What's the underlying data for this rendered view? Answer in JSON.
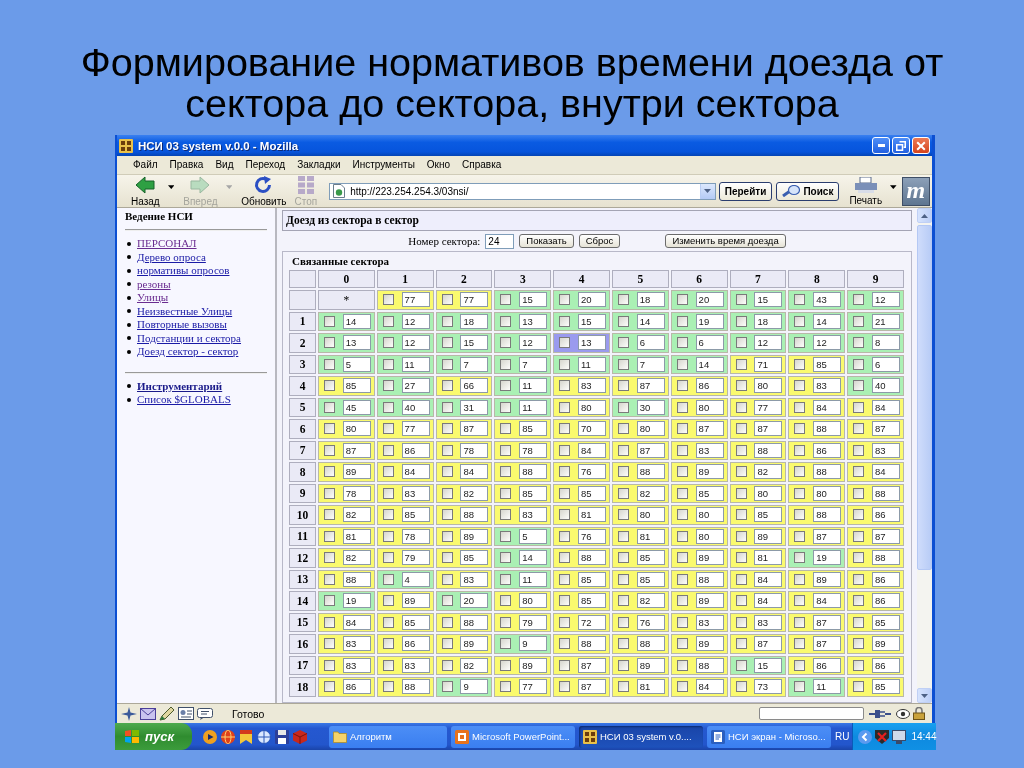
{
  "slide": {
    "title": "Формирование нормативов времени доезда от сектора до сектора, внутри сектора"
  },
  "window": {
    "title": "НСИ 03 system v.0.0 - Mozilla"
  },
  "menu": [
    "Файл",
    "Правка",
    "Вид",
    "Переход",
    "Закладки",
    "Инструменты",
    "Окно",
    "Справка"
  ],
  "toolbar": {
    "nav": [
      {
        "kind": "back",
        "label": "Назад",
        "disabled": false,
        "dropdown": true
      },
      {
        "kind": "forward",
        "label": "Вперед",
        "disabled": true,
        "dropdown": true
      },
      {
        "kind": "reload",
        "label": "Обновить",
        "disabled": false,
        "dropdown": false
      },
      {
        "kind": "stop",
        "label": "Стоп",
        "disabled": true,
        "dropdown": false
      }
    ],
    "address": "http://223.254.254.3/03nsi/",
    "go": "Перейти",
    "search": "Поиск",
    "print": "Печать",
    "logo": "m"
  },
  "sidebar": {
    "title": "Ведение НСИ",
    "groups": [
      {
        "items": [
          {
            "label": "ПЕРСОНАЛ",
            "visited": true,
            "emphasized": false
          },
          {
            "label": "Дерево опроса",
            "visited": false,
            "emphasized": false
          },
          {
            "label": "нормативы опросов",
            "visited": false,
            "emphasized": false
          },
          {
            "label": "резоны",
            "visited": true,
            "emphasized": false
          },
          {
            "label": "Улицы",
            "visited": true,
            "emphasized": false
          },
          {
            "label": "Неизвестные Улицы",
            "visited": false,
            "emphasized": false
          },
          {
            "label": "Повторные вызовы",
            "visited": false,
            "emphasized": false
          },
          {
            "label": "Подстанции и сектора",
            "visited": false,
            "emphasized": false
          },
          {
            "label": "Доезд сектор - сектор",
            "visited": false,
            "emphasized": false
          }
        ]
      },
      {
        "items": [
          {
            "label": "Инструментарий",
            "visited": false,
            "emphasized": true
          },
          {
            "label": "Список $GLOBALS",
            "visited": false,
            "emphasized": false
          }
        ]
      }
    ]
  },
  "panel": {
    "heading": "Доезд из сектора в сектор",
    "sector_label": "Номер сектора:",
    "sector_value": "24",
    "buttons": [
      "Показать",
      "Сброс"
    ],
    "change_button": "Изменить время доезда"
  },
  "table": {
    "legend": "Связанные сектора",
    "columns": [
      "0",
      "1",
      "2",
      "3",
      "4",
      "5",
      "6",
      "7",
      "8",
      "9"
    ],
    "rows": [
      {
        "cells": [
          {
            "kind": "label",
            "value": "*"
          },
          {
            "kind": "input",
            "value": "77",
            "color": "#fafa6e",
            "checked": false
          },
          {
            "kind": "input",
            "value": "77",
            "color": "#fafa6e",
            "checked": false
          },
          {
            "kind": "input",
            "value": "15",
            "color": "#aaf0b4",
            "checked": false
          },
          {
            "kind": "input",
            "value": "20",
            "color": "#aaf0b4",
            "checked": false
          },
          {
            "kind": "input",
            "value": "18",
            "color": "#aaf0b4",
            "checked": false
          },
          {
            "kind": "input",
            "value": "20",
            "color": "#aaf0b4",
            "checked": false
          },
          {
            "kind": "input",
            "value": "15",
            "color": "#aaf0b4",
            "checked": false
          },
          {
            "kind": "input",
            "value": "43",
            "color": "#aaf0b4",
            "checked": false
          },
          {
            "kind": "input",
            "value": "12",
            "color": "#aaf0b4",
            "checked": false
          }
        ]
      },
      {
        "label": "1",
        "cells": [
          {
            "value": "14",
            "color": "#aaf0b4",
            "checked": false
          },
          {
            "value": "12",
            "color": "#aaf0b4",
            "checked": false
          },
          {
            "value": "18",
            "color": "#aaf0b4",
            "checked": false
          },
          {
            "value": "13",
            "color": "#aaf0b4",
            "checked": false
          },
          {
            "value": "15",
            "color": "#aaf0b4",
            "checked": false
          },
          {
            "value": "14",
            "color": "#aaf0b4",
            "checked": false
          },
          {
            "value": "19",
            "color": "#aaf0b4",
            "checked": false
          },
          {
            "value": "18",
            "color": "#aaf0b4",
            "checked": false
          },
          {
            "value": "14",
            "color": "#aaf0b4",
            "checked": false
          },
          {
            "value": "21",
            "color": "#aaf0b4",
            "checked": false
          }
        ]
      },
      {
        "label": "2",
        "cells": [
          {
            "value": "13",
            "color": "#aaf0b4",
            "checked": false
          },
          {
            "value": "12",
            "color": "#aaf0b4",
            "checked": false
          },
          {
            "value": "15",
            "color": "#aaf0b4",
            "checked": false
          },
          {
            "value": "12",
            "color": "#aaf0b4",
            "checked": false
          },
          {
            "value": "13",
            "color": "#9a9aee",
            "checked": false
          },
          {
            "value": "6",
            "color": "#aaf0b4",
            "checked": false
          },
          {
            "value": "6",
            "color": "#aaf0b4",
            "checked": false
          },
          {
            "value": "12",
            "color": "#aaf0b4",
            "checked": false
          },
          {
            "value": "12",
            "color": "#aaf0b4",
            "checked": false
          },
          {
            "value": "8",
            "color": "#aaf0b4",
            "checked": false
          }
        ]
      },
      {
        "label": "3",
        "cells": [
          {
            "value": "5",
            "color": "#aaf0b4",
            "checked": false
          },
          {
            "value": "11",
            "color": "#aaf0b4",
            "checked": false
          },
          {
            "value": "7",
            "color": "#aaf0b4",
            "checked": false
          },
          {
            "value": "7",
            "color": "#aaf0b4",
            "checked": false
          },
          {
            "value": "11",
            "color": "#aaf0b4",
            "checked": false
          },
          {
            "value": "7",
            "color": "#aaf0b4",
            "checked": false
          },
          {
            "value": "14",
            "color": "#aaf0b4",
            "checked": false
          },
          {
            "value": "71",
            "color": "#fafa6e",
            "checked": false
          },
          {
            "value": "85",
            "color": "#fafa6e",
            "checked": false
          },
          {
            "value": "6",
            "color": "#aaf0b4",
            "checked": false
          }
        ]
      },
      {
        "label": "4",
        "cells": [
          {
            "value": "85",
            "color": "#fafa6e",
            "checked": false
          },
          {
            "value": "27",
            "color": "#aaf0b4",
            "checked": false
          },
          {
            "value": "66",
            "color": "#fafa6e",
            "checked": false
          },
          {
            "value": "11",
            "color": "#aaf0b4",
            "checked": false
          },
          {
            "value": "83",
            "color": "#fafa6e",
            "checked": false
          },
          {
            "value": "87",
            "color": "#fafa6e",
            "checked": false
          },
          {
            "value": "86",
            "color": "#fafa6e",
            "checked": false
          },
          {
            "value": "80",
            "color": "#fafa6e",
            "checked": false
          },
          {
            "value": "83",
            "color": "#fafa6e",
            "checked": false
          },
          {
            "value": "40",
            "color": "#aaf0b4",
            "checked": false
          }
        ]
      },
      {
        "label": "5",
        "cells": [
          {
            "value": "45",
            "color": "#aaf0b4",
            "checked": false
          },
          {
            "value": "40",
            "color": "#aaf0b4",
            "checked": false
          },
          {
            "value": "31",
            "color": "#aaf0b4",
            "checked": false
          },
          {
            "value": "11",
            "color": "#aaf0b4",
            "checked": false
          },
          {
            "value": "80",
            "color": "#fafa6e",
            "checked": false
          },
          {
            "value": "30",
            "color": "#aaf0b4",
            "checked": false
          },
          {
            "value": "80",
            "color": "#fafa6e",
            "checked": false
          },
          {
            "value": "77",
            "color": "#fafa6e",
            "checked": false
          },
          {
            "value": "84",
            "color": "#fafa6e",
            "checked": false
          },
          {
            "value": "84",
            "color": "#fafa6e",
            "checked": false
          }
        ]
      },
      {
        "label": "6",
        "cells": [
          {
            "value": "80",
            "color": "#fafa6e",
            "checked": false
          },
          {
            "value": "77",
            "color": "#fafa6e",
            "checked": false
          },
          {
            "value": "87",
            "color": "#fafa6e",
            "checked": false
          },
          {
            "value": "85",
            "color": "#fafa6e",
            "checked": false
          },
          {
            "value": "70",
            "color": "#fafa6e",
            "checked": false
          },
          {
            "value": "80",
            "color": "#fafa6e",
            "checked": false
          },
          {
            "value": "87",
            "color": "#fafa6e",
            "checked": false
          },
          {
            "value": "87",
            "color": "#fafa6e",
            "checked": false
          },
          {
            "value": "88",
            "color": "#fafa6e",
            "checked": false
          },
          {
            "value": "87",
            "color": "#fafa6e",
            "checked": false
          }
        ]
      },
      {
        "label": "7",
        "cells": [
          {
            "value": "87",
            "color": "#fafa6e",
            "checked": false
          },
          {
            "value": "86",
            "color": "#fafa6e",
            "checked": false
          },
          {
            "value": "78",
            "color": "#fafa6e",
            "checked": false
          },
          {
            "value": "78",
            "color": "#fafa6e",
            "checked": false
          },
          {
            "value": "84",
            "color": "#fafa6e",
            "checked": false
          },
          {
            "value": "87",
            "color": "#fafa6e",
            "checked": false
          },
          {
            "value": "83",
            "color": "#fafa6e",
            "checked": false
          },
          {
            "value": "88",
            "color": "#fafa6e",
            "checked": false
          },
          {
            "value": "86",
            "color": "#fafa6e",
            "checked": false
          },
          {
            "value": "83",
            "color": "#fafa6e",
            "checked": false
          }
        ]
      },
      {
        "label": "8",
        "cells": [
          {
            "value": "89",
            "color": "#fafa6e",
            "checked": false
          },
          {
            "value": "84",
            "color": "#fafa6e",
            "checked": false
          },
          {
            "value": "84",
            "color": "#fafa6e",
            "checked": false
          },
          {
            "value": "88",
            "color": "#fafa6e",
            "checked": false
          },
          {
            "value": "76",
            "color": "#fafa6e",
            "checked": false
          },
          {
            "value": "88",
            "color": "#fafa6e",
            "checked": false
          },
          {
            "value": "89",
            "color": "#fafa6e",
            "checked": false
          },
          {
            "value": "82",
            "color": "#fafa6e",
            "checked": false
          },
          {
            "value": "88",
            "color": "#fafa6e",
            "checked": false
          },
          {
            "value": "84",
            "color": "#fafa6e",
            "checked": false
          }
        ]
      },
      {
        "label": "9",
        "cells": [
          {
            "value": "78",
            "color": "#fafa6e",
            "checked": false
          },
          {
            "value": "83",
            "color": "#fafa6e",
            "checked": false
          },
          {
            "value": "82",
            "color": "#fafa6e",
            "checked": false
          },
          {
            "value": "85",
            "color": "#fafa6e",
            "checked": false
          },
          {
            "value": "85",
            "color": "#fafa6e",
            "checked": false
          },
          {
            "value": "82",
            "color": "#fafa6e",
            "checked": false
          },
          {
            "value": "85",
            "color": "#fafa6e",
            "checked": false
          },
          {
            "value": "80",
            "color": "#fafa6e",
            "checked": false
          },
          {
            "value": "80",
            "color": "#fafa6e",
            "checked": false
          },
          {
            "value": "88",
            "color": "#fafa6e",
            "checked": false
          }
        ]
      },
      {
        "label": "10",
        "cells": [
          {
            "value": "82",
            "color": "#fafa6e",
            "checked": false
          },
          {
            "value": "85",
            "color": "#fafa6e",
            "checked": false
          },
          {
            "value": "88",
            "color": "#fafa6e",
            "checked": false
          },
          {
            "value": "83",
            "color": "#fafa6e",
            "checked": false
          },
          {
            "value": "81",
            "color": "#fafa6e",
            "checked": false
          },
          {
            "value": "80",
            "color": "#fafa6e",
            "checked": false
          },
          {
            "value": "80",
            "color": "#fafa6e",
            "checked": false
          },
          {
            "value": "85",
            "color": "#fafa6e",
            "checked": false
          },
          {
            "value": "88",
            "color": "#fafa6e",
            "checked": false
          },
          {
            "value": "86",
            "color": "#fafa6e",
            "checked": false
          }
        ]
      },
      {
        "label": "11",
        "cells": [
          {
            "value": "81",
            "color": "#fafa6e",
            "checked": false
          },
          {
            "value": "78",
            "color": "#fafa6e",
            "checked": false
          },
          {
            "value": "89",
            "color": "#fafa6e",
            "checked": false
          },
          {
            "value": "5",
            "color": "#aaf0b4",
            "checked": false
          },
          {
            "value": "76",
            "color": "#fafa6e",
            "checked": false
          },
          {
            "value": "81",
            "color": "#fafa6e",
            "checked": false
          },
          {
            "value": "80",
            "color": "#fafa6e",
            "checked": false
          },
          {
            "value": "89",
            "color": "#fafa6e",
            "checked": false
          },
          {
            "value": "87",
            "color": "#fafa6e",
            "checked": false
          },
          {
            "value": "87",
            "color": "#fafa6e",
            "checked": false
          }
        ]
      },
      {
        "label": "12",
        "cells": [
          {
            "value": "82",
            "color": "#fafa6e",
            "checked": false
          },
          {
            "value": "79",
            "color": "#fafa6e",
            "checked": false
          },
          {
            "value": "85",
            "color": "#fafa6e",
            "checked": false
          },
          {
            "value": "14",
            "color": "#aaf0b4",
            "checked": false
          },
          {
            "value": "88",
            "color": "#fafa6e",
            "checked": false
          },
          {
            "value": "85",
            "color": "#fafa6e",
            "checked": false
          },
          {
            "value": "89",
            "color": "#fafa6e",
            "checked": false
          },
          {
            "value": "81",
            "color": "#fafa6e",
            "checked": false
          },
          {
            "value": "19",
            "color": "#aaf0b4",
            "checked": false
          },
          {
            "value": "88",
            "color": "#fafa6e",
            "checked": false
          }
        ]
      },
      {
        "label": "13",
        "cells": [
          {
            "value": "88",
            "color": "#fafa6e",
            "checked": false
          },
          {
            "value": "4",
            "color": "#aaf0b4",
            "checked": false
          },
          {
            "value": "83",
            "color": "#fafa6e",
            "checked": false
          },
          {
            "value": "11",
            "color": "#aaf0b4",
            "checked": false
          },
          {
            "value": "85",
            "color": "#fafa6e",
            "checked": false
          },
          {
            "value": "85",
            "color": "#fafa6e",
            "checked": false
          },
          {
            "value": "88",
            "color": "#fafa6e",
            "checked": false
          },
          {
            "value": "84",
            "color": "#fafa6e",
            "checked": false
          },
          {
            "value": "89",
            "color": "#fafa6e",
            "checked": false
          },
          {
            "value": "86",
            "color": "#fafa6e",
            "checked": false
          }
        ]
      },
      {
        "label": "14",
        "cells": [
          {
            "value": "19",
            "color": "#aaf0b4",
            "checked": false
          },
          {
            "value": "89",
            "color": "#fafa6e",
            "checked": false
          },
          {
            "value": "20",
            "color": "#aaf0b4",
            "checked": false
          },
          {
            "value": "80",
            "color": "#fafa6e",
            "checked": false
          },
          {
            "value": "85",
            "color": "#fafa6e",
            "checked": false
          },
          {
            "value": "82",
            "color": "#fafa6e",
            "checked": false
          },
          {
            "value": "89",
            "color": "#fafa6e",
            "checked": false
          },
          {
            "value": "84",
            "color": "#fafa6e",
            "checked": false
          },
          {
            "value": "84",
            "color": "#fafa6e",
            "checked": false
          },
          {
            "value": "86",
            "color": "#fafa6e",
            "checked": false
          }
        ]
      },
      {
        "label": "15",
        "cells": [
          {
            "value": "84",
            "color": "#fafa6e",
            "checked": false
          },
          {
            "value": "85",
            "color": "#fafa6e",
            "checked": false
          },
          {
            "value": "88",
            "color": "#fafa6e",
            "checked": false
          },
          {
            "value": "79",
            "color": "#fafa6e",
            "checked": false
          },
          {
            "value": "72",
            "color": "#fafa6e",
            "checked": false
          },
          {
            "value": "76",
            "color": "#fafa6e",
            "checked": false
          },
          {
            "value": "83",
            "color": "#fafa6e",
            "checked": false
          },
          {
            "value": "83",
            "color": "#fafa6e",
            "checked": false
          },
          {
            "value": "87",
            "color": "#fafa6e",
            "checked": false
          },
          {
            "value": "85",
            "color": "#fafa6e",
            "checked": false
          }
        ]
      },
      {
        "label": "16",
        "cells": [
          {
            "value": "83",
            "color": "#fafa6e",
            "checked": false
          },
          {
            "value": "86",
            "color": "#fafa6e",
            "checked": false
          },
          {
            "value": "89",
            "color": "#fafa6e",
            "checked": false
          },
          {
            "value": "9",
            "color": "#aaf0b4",
            "checked": false
          },
          {
            "value": "88",
            "color": "#fafa6e",
            "checked": false
          },
          {
            "value": "88",
            "color": "#fafa6e",
            "checked": false
          },
          {
            "value": "89",
            "color": "#fafa6e",
            "checked": false
          },
          {
            "value": "87",
            "color": "#fafa6e",
            "checked": false
          },
          {
            "value": "87",
            "color": "#fafa6e",
            "checked": false
          },
          {
            "value": "89",
            "color": "#fafa6e",
            "checked": false
          }
        ]
      },
      {
        "label": "17",
        "cells": [
          {
            "value": "83",
            "color": "#fafa6e",
            "checked": false
          },
          {
            "value": "83",
            "color": "#fafa6e",
            "checked": false
          },
          {
            "value": "82",
            "color": "#fafa6e",
            "checked": false
          },
          {
            "value": "89",
            "color": "#fafa6e",
            "checked": false
          },
          {
            "value": "87",
            "color": "#fafa6e",
            "checked": false
          },
          {
            "value": "89",
            "color": "#fafa6e",
            "checked": false
          },
          {
            "value": "88",
            "color": "#fafa6e",
            "checked": false
          },
          {
            "value": "15",
            "color": "#aaf0b4",
            "checked": false
          },
          {
            "value": "86",
            "color": "#fafa6e",
            "checked": false
          },
          {
            "value": "86",
            "color": "#fafa6e",
            "checked": false
          }
        ]
      },
      {
        "label": "18",
        "cells": [
          {
            "value": "86",
            "color": "#fafa6e",
            "checked": false
          },
          {
            "value": "88",
            "color": "#fafa6e",
            "checked": false
          },
          {
            "value": "9",
            "color": "#aaf0b4",
            "checked": false
          },
          {
            "value": "77",
            "color": "#fafa6e",
            "checked": false
          },
          {
            "value": "87",
            "color": "#fafa6e",
            "checked": false
          },
          {
            "value": "81",
            "color": "#fafa6e",
            "checked": false
          },
          {
            "value": "84",
            "color": "#fafa6e",
            "checked": false
          },
          {
            "value": "73",
            "color": "#fafa6e",
            "checked": false
          },
          {
            "value": "11",
            "color": "#aaf0b4",
            "checked": false
          },
          {
            "value": "85",
            "color": "#fafa6e",
            "checked": false
          }
        ]
      }
    ]
  },
  "status_bar": {
    "text": "Готово"
  },
  "taskbar": {
    "start": "пуск",
    "tasks": [
      {
        "kind": "folder",
        "label": "Алгоритм",
        "selected": false
      },
      {
        "kind": "presentation",
        "label": "Microsoft PowerPoint...",
        "selected": false
      },
      {
        "kind": "browser",
        "label": "НСИ 03 system v.0....",
        "selected": true
      },
      {
        "kind": "document",
        "label": "НСИ экран - Microso...",
        "selected": false
      }
    ],
    "language": "RU",
    "clock": "14:44"
  }
}
